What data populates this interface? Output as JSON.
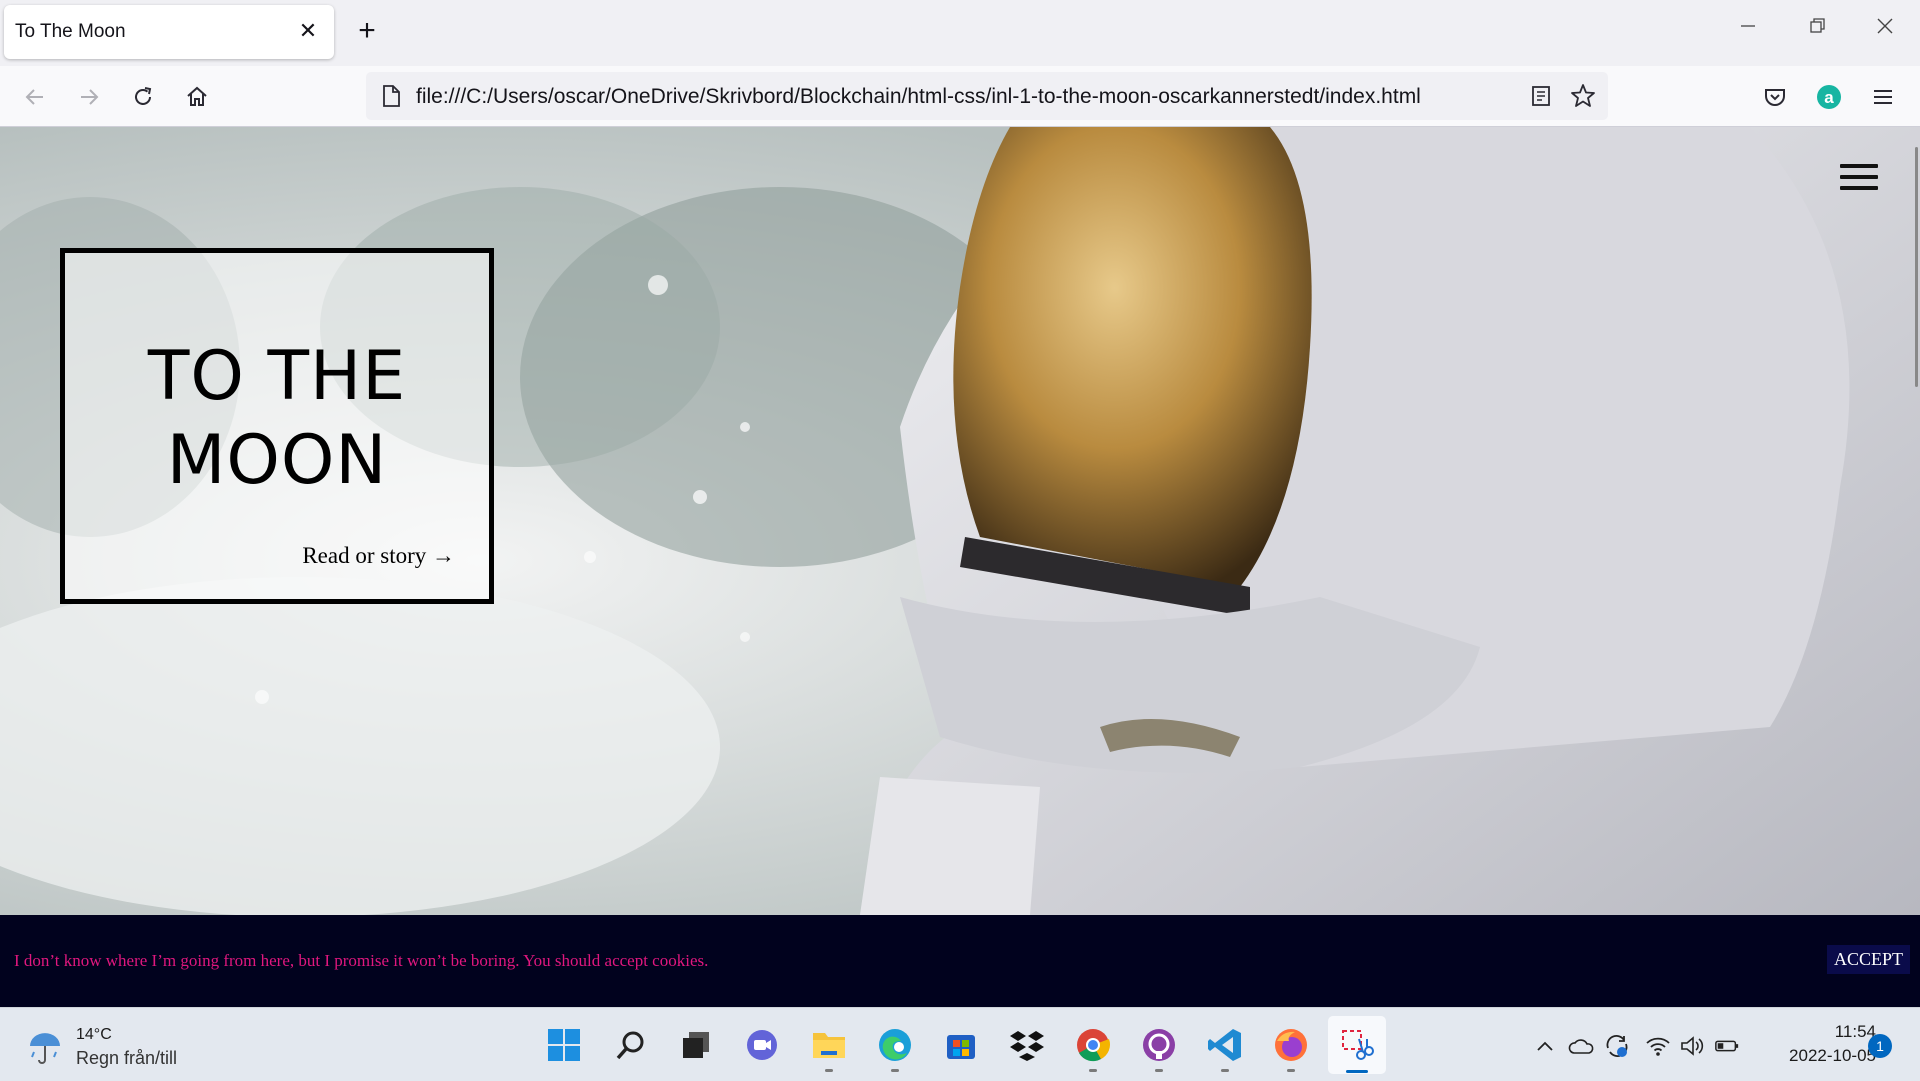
{
  "browser": {
    "tab_title": "To The Moon",
    "tab_close_symbol": "✕",
    "new_tab_symbol": "+",
    "url": "file:///C:/Users/oscar/OneDrive/Skrivbord/Blockchain/html-css/inl-1-to-the-moon-oscarkannerstedt/index.html",
    "window_controls": [
      "minimize-icon",
      "restore-icon",
      "close-icon"
    ],
    "nav_icons": [
      "back-arrow-icon",
      "forward-arrow-icon",
      "reload-icon",
      "home-icon"
    ],
    "toolbar_icons": [
      "reader-view-icon",
      "bookmark-star-icon",
      "pocket-icon",
      "account-icon",
      "menu-icon"
    ]
  },
  "page": {
    "hero_title": "TO THE MOON",
    "hero_link": "Read or story →",
    "cookie_text": "I don’t know where I’m going from here, but I promise it won’t be boring. You should accept cookies.",
    "accept_label": "ACCEPT",
    "colors": {
      "cookie_bg": "#01021e",
      "cookie_text": "#e0177e",
      "accept_bg": "#0a0b4a"
    }
  },
  "taskbar": {
    "weather_temp": "14°C",
    "weather_desc": "Regn från/till",
    "apps": [
      "start-icon",
      "search-icon",
      "task-view-icon",
      "teams-chat-icon",
      "file-explorer-icon",
      "edge-icon",
      "store-icon",
      "dropbox-icon",
      "chrome-icon",
      "github-desktop-icon",
      "vscode-icon",
      "firefox-icon",
      "snipping-tool-icon"
    ],
    "tray": [
      "chevron-up-icon",
      "onedrive-icon",
      "sync-icon",
      "wifi-icon",
      "volume-icon",
      "battery-icon"
    ],
    "time": "11:54",
    "date": "2022-10-05",
    "notification_count": "1"
  }
}
